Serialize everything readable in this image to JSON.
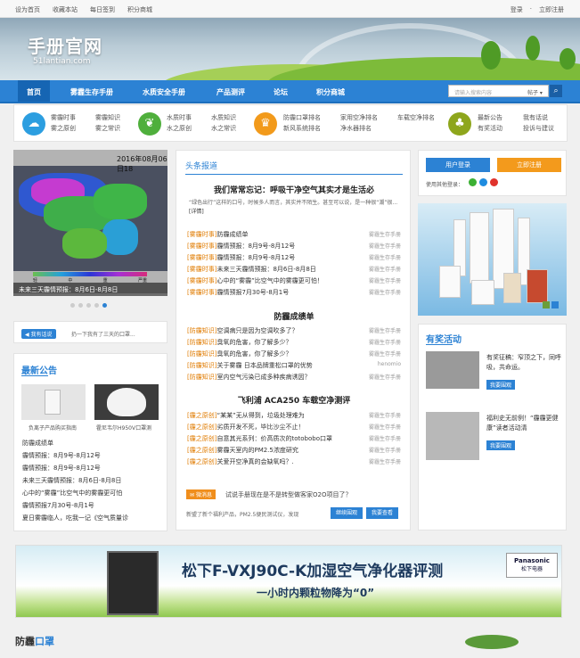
{
  "topbar": {
    "links": [
      "设为首页",
      "收藏本站",
      "每日签到",
      "积分商城"
    ],
    "login": "登录",
    "register": "立即注册"
  },
  "logo": {
    "title": "手册官网",
    "domain": "51lantian.com"
  },
  "nav": {
    "items": [
      "首页",
      "雾霾生存手册",
      "水质安全手册",
      "产品测评",
      "论坛",
      "积分商城"
    ],
    "search_placeholder": "请输入搜索内容",
    "search_select": "帖子"
  },
  "categories": [
    {
      "icon": "cloud-icon",
      "color": "#2c9ee0",
      "links": [
        "雾霾时事",
        "雾霾知识",
        "雾之原创",
        "雾之常识"
      ]
    },
    {
      "icon": "leaf-icon",
      "color": "#4faf3c",
      "links": [
        "水质时事",
        "水质知识",
        "水之原创",
        "水之常识"
      ]
    },
    {
      "icon": "crown-icon",
      "color": "#f29a1b",
      "links": [
        "防霾口罩排名",
        "家用空净排名",
        "车载空净排名",
        "新风系统排名",
        "净水器排名"
      ]
    },
    {
      "icon": "users-icon",
      "color": "#8ea61c",
      "links": [
        "最新公告",
        "我有话说",
        "有奖活动",
        "投诉与建议"
      ]
    }
  ],
  "map": {
    "date_label": "2016年08月06日18",
    "caption": "未来三天霾情预报：8月6日-8月8日",
    "legend_labels": [
      "轻",
      "中",
      "重",
      "严重"
    ]
  },
  "talk": {
    "tag": "我有话说",
    "text": "扔一下我有了三天的口罩..."
  },
  "notice": {
    "title": "最新公告",
    "thumbs": [
      "负离子产品购买指南",
      "霍尼韦尔H950V口罩测"
    ],
    "list": [
      "防霾成绩单",
      "霾情预报：8月9号-8月12号",
      "霾情预报：8月9号-8月12号",
      "未来三天霾情预报：8月6日-8月8日",
      "心中的“雾霾”比空气中的雾霾更可怕",
      "霾情预报7月30号-8月1号",
      "夏日雾霾临人，吃我一记《空气质量诊"
    ]
  },
  "center": {
    "tab": "头条报道",
    "headline": "我们常常忘记：呼吸干净空气其实才是生活必",
    "summary": "“绿色出行”这样的口号，时候多人而言，其实并不陌生。甚至可以说，是一种很“潮”很...",
    "summary_link": "[详情]",
    "sec1": [
      {
        "cat": "[雾霾时事]",
        "title": "防霾成绩单",
        "src": "雾霾生存手册"
      },
      {
        "cat": "[雾霾时事]",
        "title": "霾情预报：8月9号-8月12号",
        "src": "雾霾生存手册"
      },
      {
        "cat": "[雾霾时事]",
        "title": "霾情预报：8月9号-8月12号",
        "src": "雾霾生存手册"
      },
      {
        "cat": "[雾霾时事]",
        "title": "未来三天霾情预报：8月6日-8月8日",
        "src": "雾霾生存手册"
      },
      {
        "cat": "[雾霾时事]",
        "title": "心中的“雾霾”比空气中的雾霾更可怕！",
        "src": "雾霾生存手册"
      },
      {
        "cat": "[雾霾时事]",
        "title": "霾情预报7月30号-8月1号",
        "src": "雾霾生存手册"
      }
    ],
    "sec2_title": "防霾成绩单",
    "sec2": [
      {
        "cat": "[防霾知识]",
        "title": "空调病只是因为空调吹多了？",
        "src": "雾霾生存手册"
      },
      {
        "cat": "[防霾知识]",
        "title": "臭氧的危害，你了解多少？",
        "src": "雾霾生存手册"
      },
      {
        "cat": "[防霾知识]",
        "title": "臭氧的危害，你了解多少？",
        "src": "雾霾生存手册"
      },
      {
        "cat": "[防霾知识]",
        "title": "关于雾霾 日本品牌重松口罩的优势",
        "src": "henomio"
      },
      {
        "cat": "[防霾知识]",
        "title": "室内空气污染已成多种疾病诱因？",
        "src": "雾霾生存手册"
      }
    ],
    "sec3_title": "飞利浦 ACA250 车载空净测评",
    "sec3": [
      {
        "cat": "[霾之原创]",
        "title": "“某某”无从得到，垃圾处理难为",
        "src": "雾霾生存手册"
      },
      {
        "cat": "[霾之原创]",
        "title": "劣质开发不死，毕比沙尘不止！",
        "src": "雾霾生存手册"
      },
      {
        "cat": "[霾之原创]",
        "title": "自意其光系列：价高质次的totobobo口罩",
        "src": "雾霾生存手册"
      },
      {
        "cat": "[霾之原创]",
        "title": "雾霾天室内的PM2.5浓度研究",
        "src": "雾霾生存手册"
      },
      {
        "cat": "[霾之原创]",
        "title": "关爱开空净真的会缺氧吗？.",
        "src": "雾霾生存手册"
      }
    ],
    "wmsg_tag": "微消息",
    "wmsg_text": "试说手册现在是不是转型做客家O2O项目了？",
    "foot_text": "新盟了新个福利产品，PM2.5便民测试仪，发现",
    "btn1": "继续围观",
    "btn2": "我要查看"
  },
  "user": {
    "login": "用户登录",
    "register": "立即注册",
    "other": "使用其他登录："
  },
  "activity": {
    "title": "有奖活动",
    "items": [
      {
        "text": "有奖征稿：窄顶之下，同呼吸，共命运。",
        "btn": "我要围观"
      },
      {
        "text": "福利史无前例！“霾霾更健康”读者活动清",
        "btn": "我要围观"
      }
    ]
  },
  "bigad": {
    "title": "松下F-VXJ90C-K加湿空气净化器评测",
    "sub": "一小时内颗粒物降为“0”",
    "brand": "Panasonic",
    "brand_sub": "松下电器"
  },
  "bottom": {
    "title_a": "防霾",
    "title_b": "口罩"
  }
}
